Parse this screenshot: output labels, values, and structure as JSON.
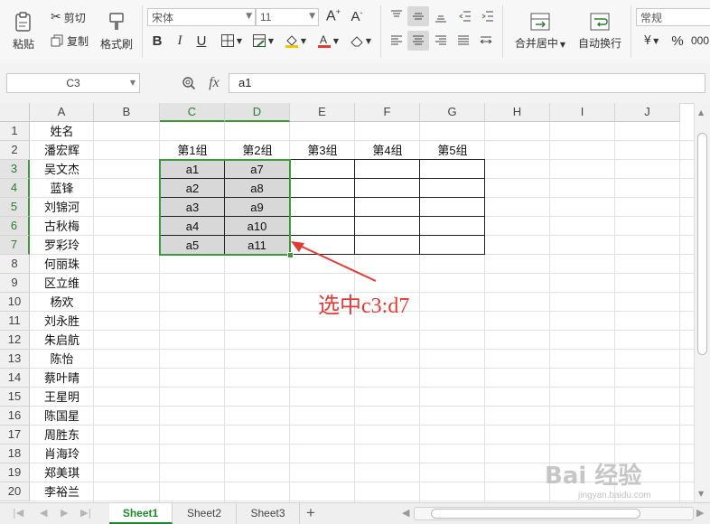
{
  "ribbon": {
    "paste": "粘贴",
    "cut": "剪切",
    "copy": "复制",
    "format_painter": "格式刷",
    "font_name": "宋体",
    "font_size": "11",
    "merge_center": "合并居中",
    "wrap_text": "自动换行",
    "number_format": "常规"
  },
  "formula_bar": {
    "name_box": "C3",
    "fx": "fx",
    "content": "a1"
  },
  "columns": [
    "A",
    "B",
    "C",
    "D",
    "E",
    "F",
    "G",
    "H",
    "I",
    "J"
  ],
  "rows": [
    "1",
    "2",
    "3",
    "4",
    "5",
    "6",
    "7",
    "8",
    "9",
    "10",
    "11",
    "12",
    "13",
    "14",
    "15",
    "16",
    "17",
    "18",
    "19",
    "20"
  ],
  "names": [
    "姓名",
    "潘宏辉",
    "吴文杰",
    "蓝锋",
    "刘锦河",
    "古秋梅",
    "罗彩玲",
    "何丽珠",
    "区立维",
    "杨欢",
    "刘永胜",
    "朱启航",
    "陈怡",
    "蔡叶晴",
    "王星明",
    "陈国星",
    "周胜东",
    "肖海玲",
    "郑美琪",
    "李裕兰"
  ],
  "table": {
    "headers": [
      "第1组",
      "第2组",
      "第3组",
      "第4组",
      "第5组"
    ],
    "rows": [
      [
        "a1",
        "a7",
        "",
        "",
        ""
      ],
      [
        "a2",
        "a8",
        "",
        "",
        ""
      ],
      [
        "a3",
        "a9",
        "",
        "",
        ""
      ],
      [
        "a4",
        "a10",
        "",
        "",
        ""
      ],
      [
        "a5",
        "a11",
        "",
        "",
        ""
      ]
    ]
  },
  "annotation": "选中c3:d7",
  "sheets": [
    "Sheet1",
    "Sheet2",
    "Sheet3"
  ],
  "active_sheet": "Sheet1",
  "watermark": "Bai 经验",
  "watermark_sub": "jingyan.baidu.com",
  "colors": {
    "accent": "#3c9a3c",
    "annotation": "#e53935",
    "selection_fill": "#d8d8d8"
  }
}
